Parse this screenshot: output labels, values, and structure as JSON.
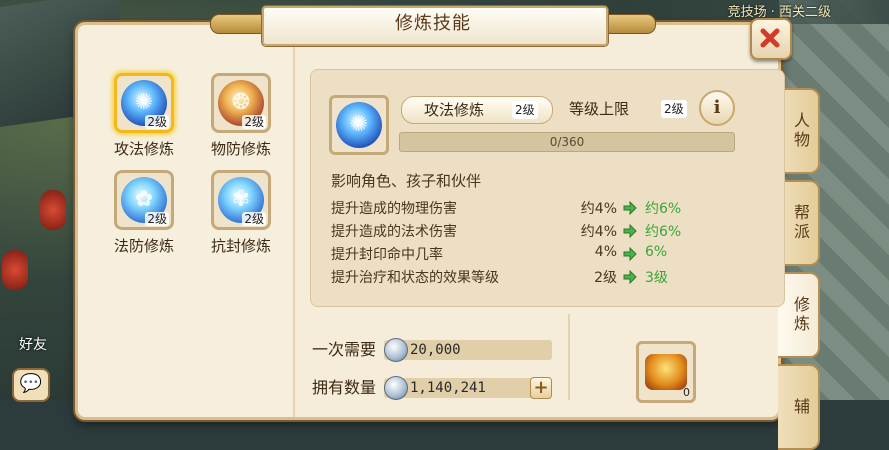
{
  "scene": {
    "top_right_text": "竞技场 · 西关二级",
    "friend_label": "好友",
    "chat_icon": "chat-bubble-icon"
  },
  "panel": {
    "title": "修炼技能"
  },
  "tabs": [
    {
      "label": "人物",
      "active": false
    },
    {
      "label": "帮派",
      "active": false
    },
    {
      "label": "修炼",
      "active": true
    },
    {
      "label": "辅",
      "active": false
    }
  ],
  "skills": [
    {
      "name": "攻法修炼",
      "level": "2级",
      "icon": "attack-magic-orb-icon",
      "selected": true
    },
    {
      "name": "物防修炼",
      "level": "2级",
      "icon": "physical-defense-orb-icon",
      "selected": false
    },
    {
      "name": "法防修炼",
      "level": "2级",
      "icon": "magic-defense-orb-icon",
      "selected": false
    },
    {
      "name": "抗封修炼",
      "level": "2级",
      "icon": "seal-resist-orb-icon",
      "selected": false
    }
  ],
  "detail": {
    "skill_name": "攻法修炼",
    "skill_level": "2级",
    "cap_label": "等级上限",
    "cap_level": "2级",
    "info_button": "i",
    "progress_text": "0/360",
    "progress_current": 0,
    "progress_max": 360,
    "affects": "影响角色、孩子和伙伴",
    "effects": [
      {
        "label": "提升造成的物理伤害",
        "current": "约4%",
        "next": "约6%"
      },
      {
        "label": "提升造成的法术伤害",
        "current": "约4%",
        "next": "约6%"
      },
      {
        "label": "提升封印命中几率",
        "current": "4%",
        "next": "6%"
      },
      {
        "label": "提升治疗和状态的效果等级",
        "current": "2级",
        "next": "3级"
      }
    ]
  },
  "cost": {
    "need_label": "一次需要",
    "need_value": "20,000",
    "have_label": "拥有数量",
    "have_value": "1,140,241",
    "plus_label": "+",
    "currency_icon": "silver-coin-icon"
  },
  "item": {
    "icon": "treasure-chest-icon",
    "count": "0"
  },
  "colors": {
    "panel_bg": "#f5ecd9",
    "detail_bg": "#ecdfc3",
    "accent_gold": "#f5b917",
    "next_value_green": "#3aa63a",
    "close_red": "#d23a2a"
  }
}
